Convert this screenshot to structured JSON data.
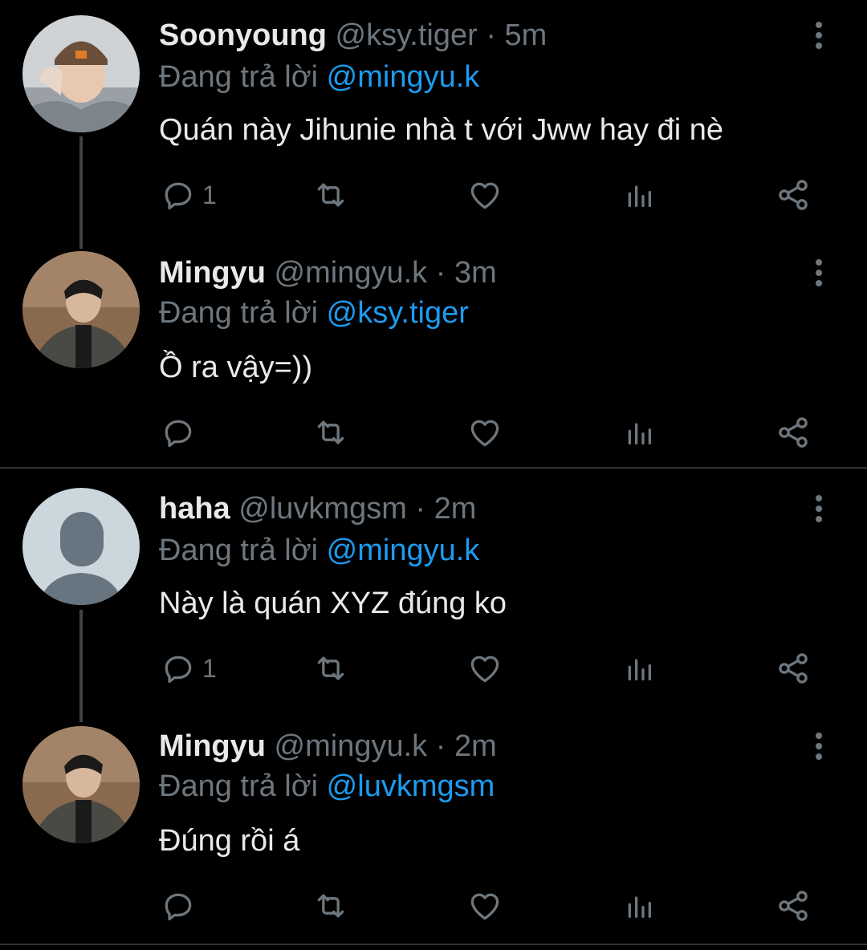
{
  "tweets": [
    {
      "name": "Soonyoung",
      "handle": "@ksy.tiger",
      "dot": "·",
      "time": "5m",
      "reply_prefix": "Đang trả lời",
      "reply_to": "@mingyu.k",
      "text": "Quán này Jihunie nhà t với Jww hay đi nè",
      "reply_count": "1"
    },
    {
      "name": "Mingyu",
      "handle": "@mingyu.k",
      "dot": "·",
      "time": "3m",
      "reply_prefix": "Đang trả lời",
      "reply_to": "@ksy.tiger",
      "text": "Ồ ra vậy=))",
      "reply_count": ""
    },
    {
      "name": "haha",
      "handle": "@luvkmgsm",
      "dot": "·",
      "time": "2m",
      "reply_prefix": "Đang trả lời",
      "reply_to": "@mingyu.k",
      "text": "Này là quán XYZ đúng ko",
      "reply_count": "1"
    },
    {
      "name": "Mingyu",
      "handle": "@mingyu.k",
      "dot": "·",
      "time": "2m",
      "reply_prefix": "Đang trả lời",
      "reply_to": "@luvkmgsm",
      "text": "Đúng rồi á",
      "reply_count": ""
    }
  ],
  "icons": {
    "reply": "reply-icon",
    "retweet": "retweet-icon",
    "like": "heart-icon",
    "views": "analytics-icon",
    "share": "share-icon",
    "more": "more-vertical-icon"
  },
  "colors": {
    "background": "#000000",
    "text": "#e7e9ea",
    "muted": "#6e767d",
    "mention": "#1d9bf0",
    "divider": "#2f3336"
  }
}
